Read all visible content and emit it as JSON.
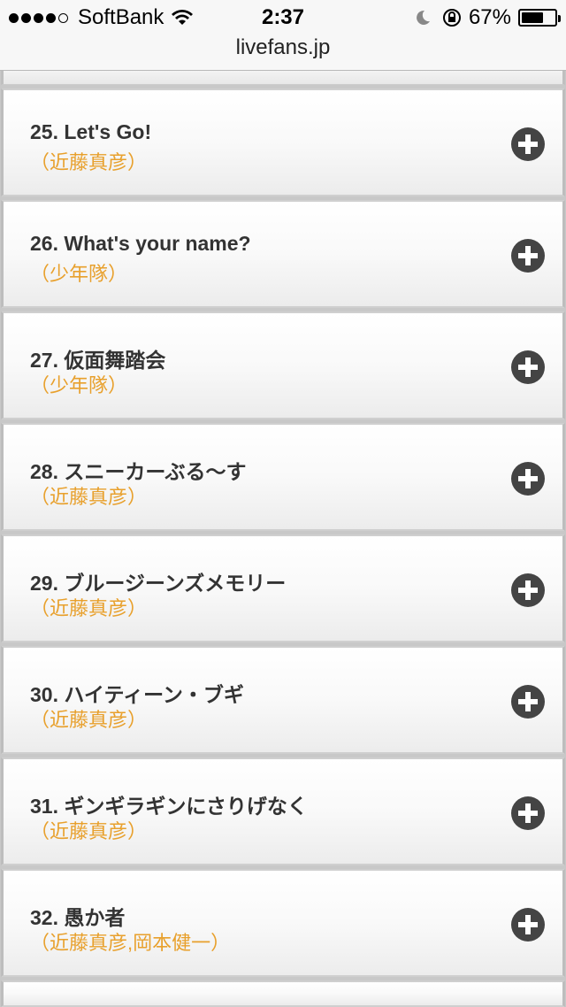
{
  "status_bar": {
    "carrier": "SoftBank",
    "time": "2:37",
    "battery": "67%",
    "battery_level": 0.67
  },
  "browser": {
    "url": "livefans.jp"
  },
  "songs": [
    {
      "title": "25. Let's Go!",
      "artist": "（近藤真彦）"
    },
    {
      "title": "26. What's your name?",
      "artist": "（少年隊）"
    },
    {
      "title": "27. 仮面舞踏会",
      "artist": "（少年隊）"
    },
    {
      "title": "28. スニーカーぶる～す",
      "artist": "（近藤真彦）"
    },
    {
      "title": "29. ブルージーンズメモリー",
      "artist": "（近藤真彦）"
    },
    {
      "title": "30. ハイティーン・ブギ",
      "artist": "（近藤真彦）"
    },
    {
      "title": "31. ギンギラギンにさりげなく",
      "artist": "（近藤真彦）"
    },
    {
      "title": "32. 愚か者",
      "artist": "（近藤真彦,岡本健一）"
    }
  ],
  "icons": {
    "expand": "plus-circle-icon"
  },
  "colors": {
    "artist": "#e8a02c",
    "title": "#333333"
  }
}
